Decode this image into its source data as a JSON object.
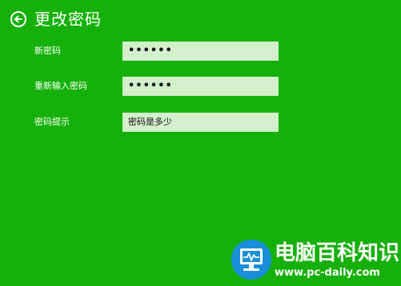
{
  "header": {
    "back_icon": "arrow-left-circle-icon",
    "title": "更改密码"
  },
  "form": {
    "new_password": {
      "label": "新密码",
      "value": "••••••"
    },
    "confirm_password": {
      "label": "重新输入密码",
      "value": "••••••"
    },
    "password_hint": {
      "label": "密码提示",
      "value": "密码是多少"
    }
  },
  "watermark": {
    "logo_icon": "monitor-pulse-icon",
    "title": "电脑百科知识",
    "url": "www.pc-daily.com"
  },
  "colors": {
    "background": "#15b10a",
    "field_background": "#d3efcb",
    "watermark_logo": "#1a8fd8"
  }
}
